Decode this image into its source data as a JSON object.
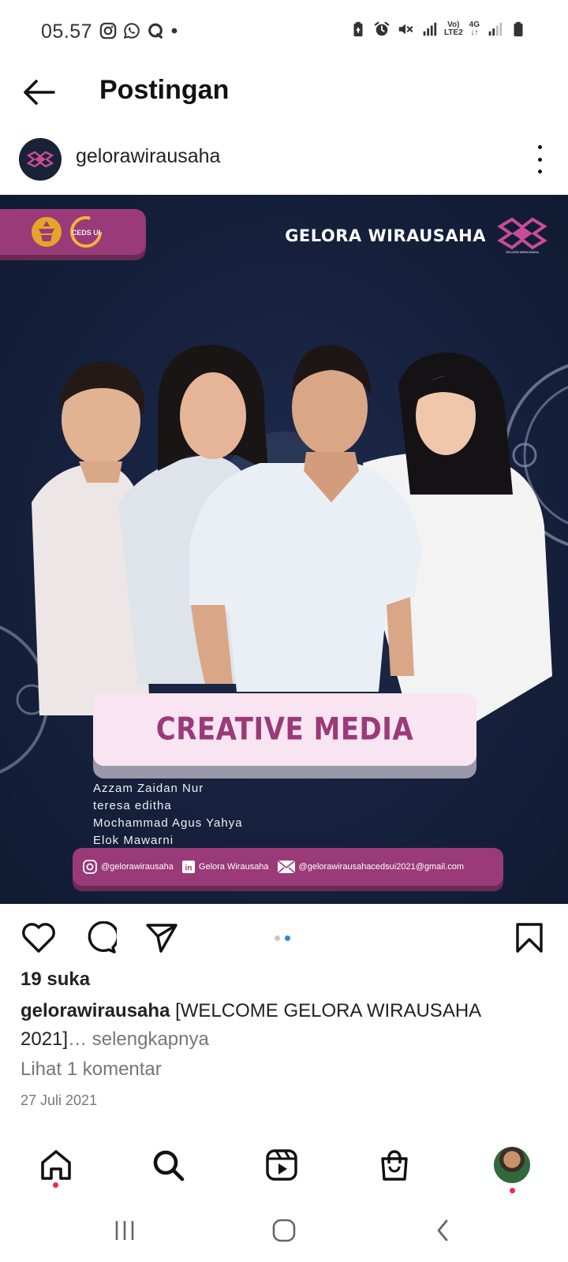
{
  "status_bar": {
    "time": "05.57",
    "network_top": "Vo)",
    "network_bottom": "LTE2",
    "network_type": "4G",
    "left_icons": [
      "instagram-icon",
      "whatsapp-icon",
      "chat-bubble-icon",
      "dot-icon"
    ],
    "right_icons": [
      "battery-saver-icon",
      "alarm-icon",
      "mute-icon",
      "signal-icon",
      "signal-icon",
      "battery-icon"
    ]
  },
  "header": {
    "title": "Postingan",
    "back_icon": "arrow-left-icon"
  },
  "post": {
    "account": "gelorawirausaha",
    "image": {
      "brand_name": "GELORA WIRAUSAHA",
      "brand_logo_caption": "GELORA WIRAUSAHA",
      "partner_logo_text": "CEDS UI",
      "title": "CREATIVE MEDIA",
      "names": [
        "Azzam Zaidan Nur",
        "teresa editha",
        "Mochammad Agus Yahya",
        "Elok Mawarni"
      ],
      "contacts": {
        "instagram": "@gelorawirausaha",
        "linkedin": "Gelora Wirausaha",
        "email": "@gelorawirausahacedsui2021@gmail.com"
      }
    },
    "carousel": {
      "count": 2,
      "active_index": 1
    },
    "likes": "19 suka",
    "caption_user": "gelorawirausaha",
    "caption_text": "[WELCOME GELORA WIRAUSAHA 2021]",
    "caption_more": "… selengkapnya",
    "comments_link": "Lihat 1 komentar",
    "date": "27 Juli 2021"
  },
  "actions": [
    "heart-icon",
    "comment-icon",
    "share-icon",
    "bookmark-icon"
  ],
  "bottom_nav": [
    "home-icon",
    "search-icon",
    "reels-icon",
    "shop-icon",
    "profile-avatar"
  ],
  "system_nav": [
    "recent-apps-icon",
    "home-circle-icon",
    "back-chevron-icon"
  ],
  "colors": {
    "brand_magenta": "#9a3a78",
    "brand_navy": "#16213d",
    "caption_pink": "#f9e4f2",
    "notification": "#ed2b4a",
    "carousel_active": "#2b8ad8"
  }
}
